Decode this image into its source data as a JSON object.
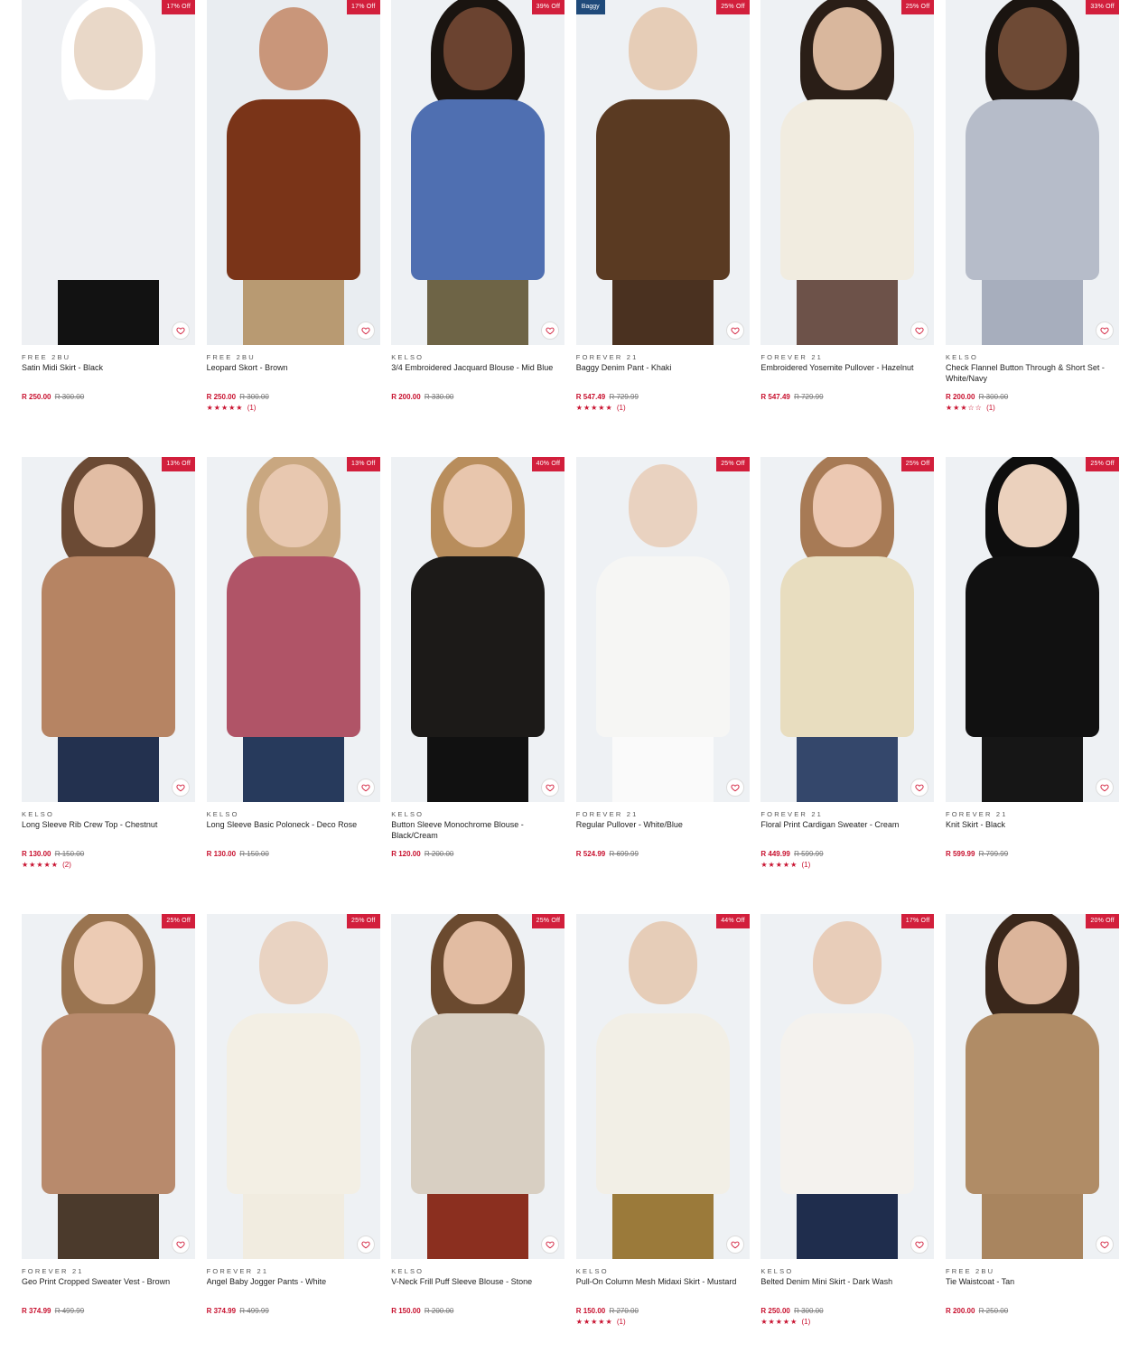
{
  "products": [
    {
      "brand": "FREE 2BU",
      "name": "Satin Midi Skirt - Black",
      "price": "R 250.00",
      "was": "R 300.00",
      "badge": "17% Off",
      "tag": "",
      "stars": "",
      "count": "",
      "colors": {
        "bg": "#eef0f3",
        "hair": "#ffffff",
        "skin": "#e9d8c8",
        "top": "#eef0f3",
        "bottom": "#121212"
      }
    },
    {
      "brand": "FREE 2BU",
      "name": "Leopard Skort - Brown",
      "price": "R 250.00",
      "was": "R 300.00",
      "badge": "17% Off",
      "tag": "",
      "stars": "★★★★★",
      "count": "(1)",
      "colors": {
        "bg": "#e9edf1",
        "hair": "#e9edf1",
        "skin": "#c9967a",
        "top": "#7a3418",
        "bottom": "#b89a72"
      }
    },
    {
      "brand": "KELSO",
      "name": "3/4 Embroidered Jacquard Blouse - Mid Blue",
      "price": "R 200.00",
      "was": "R 330.00",
      "badge": "39% Off",
      "tag": "",
      "stars": "",
      "count": "",
      "colors": {
        "bg": "#eef1f4",
        "hair": "#1a1410",
        "skin": "#6b4330",
        "top": "#4f6fb1",
        "bottom": "#6e6446"
      }
    },
    {
      "brand": "FOREVER 21",
      "name": "Baggy Denim Pant - Khaki",
      "price": "R 547.49",
      "was": "R 729.99",
      "badge": "25% Off",
      "tag": "Baggy",
      "stars": "★★★★★",
      "count": "(1)",
      "colors": {
        "bg": "#eef1f4",
        "hair": "#eef1f4",
        "skin": "#e6cdb7",
        "top": "#5a3a22",
        "bottom": "#4a3120"
      }
    },
    {
      "brand": "FOREVER 21",
      "name": "Embroidered Yosemite Pullover - Hazelnut",
      "price": "R 547.49",
      "was": "R 729.99",
      "badge": "25% Off",
      "tag": "",
      "stars": "",
      "count": "",
      "colors": {
        "bg": "#eef1f4",
        "hair": "#2a1e17",
        "skin": "#d9b79d",
        "top": "#f1ece0",
        "bottom": "#6d5249"
      }
    },
    {
      "brand": "KELSO",
      "name": "Check Flannel Button Through & Short Set - White/Navy",
      "price": "R 200.00",
      "was": "R 300.00",
      "badge": "33% Off",
      "tag": "",
      "stars": "★★★☆☆",
      "count": "(1)",
      "colors": {
        "bg": "#eef1f4",
        "hair": "#1a1410",
        "skin": "#6e4a35",
        "top": "#b6bcc9",
        "bottom": "#a7aebd"
      }
    },
    {
      "brand": "KELSO",
      "name": "Long Sleeve Rib Crew Top - Chestnut",
      "price": "R 130.00",
      "was": "R 150.00",
      "badge": "13% Off",
      "tag": "",
      "stars": "★★★★★",
      "count": "(2)",
      "colors": {
        "bg": "#eef1f4",
        "hair": "#6b4a34",
        "skin": "#e2bda4",
        "top": "#b68463",
        "bottom": "#23314f"
      }
    },
    {
      "brand": "KELSO",
      "name": "Long Sleeve Basic Poloneck - Deco Rose",
      "price": "R 130.00",
      "was": "R 150.00",
      "badge": "13% Off",
      "tag": "",
      "stars": "",
      "count": "",
      "colors": {
        "bg": "#eef1f4",
        "hair": "#c9a780",
        "skin": "#e8c8b0",
        "top": "#b05467",
        "bottom": "#273a5c"
      }
    },
    {
      "brand": "KELSO",
      "name": "Button Sleeve Monochrome Blouse - Black/Cream",
      "price": "R 120.00",
      "was": "R 200.00",
      "badge": "40% Off",
      "tag": "",
      "stars": "",
      "count": "",
      "colors": {
        "bg": "#eef1f4",
        "hair": "#b88d5c",
        "skin": "#e8c6ad",
        "top": "#1c1a18",
        "bottom": "#111111"
      }
    },
    {
      "brand": "FOREVER 21",
      "name": "Regular Pullover - White/Blue",
      "price": "R 524.99",
      "was": "R 699.99",
      "badge": "25% Off",
      "tag": "",
      "stars": "",
      "count": "",
      "colors": {
        "bg": "#eef1f4",
        "hair": "#eef1f4",
        "skin": "#e9d2c0",
        "top": "#f6f6f4",
        "bottom": "#fafafa"
      }
    },
    {
      "brand": "FOREVER 21",
      "name": "Floral Print Cardigan Sweater - Cream",
      "price": "R 449.99",
      "was": "R 599.99",
      "badge": "25% Off",
      "tag": "",
      "stars": "★★★★★",
      "count": "(1)",
      "colors": {
        "bg": "#eef1f4",
        "hair": "#a77a55",
        "skin": "#ecc8b2",
        "top": "#e8ddbf",
        "bottom": "#34476b"
      }
    },
    {
      "brand": "FOREVER 21",
      "name": "Knit Skirt - Black",
      "price": "R 599.99",
      "was": "R 799.99",
      "badge": "25% Off",
      "tag": "",
      "stars": "",
      "count": "",
      "colors": {
        "bg": "#eef1f4",
        "hair": "#0e0e0e",
        "skin": "#ebd1bd",
        "top": "#111111",
        "bottom": "#161616"
      }
    },
    {
      "brand": "FOREVER 21",
      "name": "Geo Print Cropped Sweater Vest - Brown",
      "price": "R 374.99",
      "was": "R 499.99",
      "badge": "25% Off",
      "tag": "",
      "stars": "",
      "count": "",
      "colors": {
        "bg": "#eef1f4",
        "hair": "#9a7450",
        "skin": "#eccbb4",
        "top": "#b88a6c",
        "bottom": "#4b3a2c"
      }
    },
    {
      "brand": "FOREVER 21",
      "name": "Angel Baby Jogger Pants - White",
      "price": "R 374.99",
      "was": "R 499.99",
      "badge": "25% Off",
      "tag": "",
      "stars": "",
      "count": "",
      "colors": {
        "bg": "#eef1f4",
        "hair": "#eef1f4",
        "skin": "#e9d3c2",
        "top": "#f3efe4",
        "bottom": "#f1ece0"
      }
    },
    {
      "brand": "KELSO",
      "name": "V-Neck Frill Puff Sleeve Blouse - Stone",
      "price": "R 150.00",
      "was": "R 200.00",
      "badge": "25% Off",
      "tag": "",
      "stars": "",
      "count": "",
      "colors": {
        "bg": "#eef1f4",
        "hair": "#6b4a2f",
        "skin": "#e2bca2",
        "top": "#d8cfc2",
        "bottom": "#8b2f1f"
      }
    },
    {
      "brand": "KELSO",
      "name": "Pull-On Column Mesh Midaxi Skirt - Mustard",
      "price": "R 150.00",
      "was": "R 270.00",
      "badge": "44% Off",
      "tag": "",
      "stars": "★★★★★",
      "count": "(1)",
      "colors": {
        "bg": "#eef1f4",
        "hair": "#eef1f4",
        "skin": "#e6cdb8",
        "top": "#f2efe6",
        "bottom": "#9b7a3a"
      }
    },
    {
      "brand": "KELSO",
      "name": "Belted Denim Mini Skirt - Dark Wash",
      "price": "R 250.00",
      "was": "R 300.00",
      "badge": "17% Off",
      "tag": "",
      "stars": "★★★★★",
      "count": "(1)",
      "colors": {
        "bg": "#eef1f4",
        "hair": "#eef1f4",
        "skin": "#e8cdb9",
        "top": "#f4f2ee",
        "bottom": "#1f2d4d"
      }
    },
    {
      "brand": "FREE 2BU",
      "name": "Tie Waistcoat - Tan",
      "price": "R 200.00",
      "was": "R 250.00",
      "badge": "20% Off",
      "tag": "",
      "stars": "",
      "count": "",
      "colors": {
        "bg": "#eef1f4",
        "hair": "#3a271b",
        "skin": "#dcb59b",
        "top": "#b08c66",
        "bottom": "#a9855f"
      }
    }
  ]
}
